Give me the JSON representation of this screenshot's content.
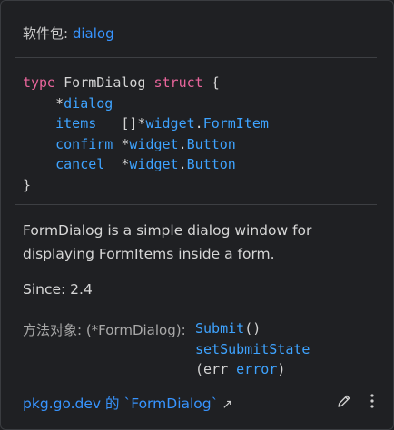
{
  "header": {
    "package_label": "软件包:",
    "package_name": "dialog"
  },
  "code": {
    "kw_type": "type",
    "type_name": "FormDialog",
    "kw_struct": "struct",
    "open_brace": "{",
    "close_brace": "}",
    "fields": [
      {
        "star": "*",
        "name": "",
        "pkg": "",
        "dot": "",
        "type": "dialog"
      },
      {
        "name": "items",
        "star": "[]*",
        "pkg": "widget",
        "dot": ".",
        "type": "FormItem"
      },
      {
        "name": "confirm",
        "star": "*",
        "pkg": "widget",
        "dot": ".",
        "type": "Button"
      },
      {
        "name": "cancel",
        "star": "*",
        "pkg": "widget",
        "dot": ".",
        "type": "Button"
      }
    ]
  },
  "description": "FormDialog is a simple dialog window for displaying FormItems inside a form.",
  "since": "Since: 2.4",
  "methods": {
    "label": "方法对象: (*FormDialog):",
    "items": [
      {
        "name": "Submit",
        "args": "()"
      },
      {
        "name": "setSubmitState",
        "args": ""
      }
    ],
    "args_line": {
      "open": "(err ",
      "type": "error",
      "close": ")"
    }
  },
  "footer": {
    "link_text": "pkg.go.dev 的 `FormDialog`",
    "arrow": "↗",
    "edit_icon": "pencil-icon",
    "more_icon": "kebab-menu-icon"
  }
}
